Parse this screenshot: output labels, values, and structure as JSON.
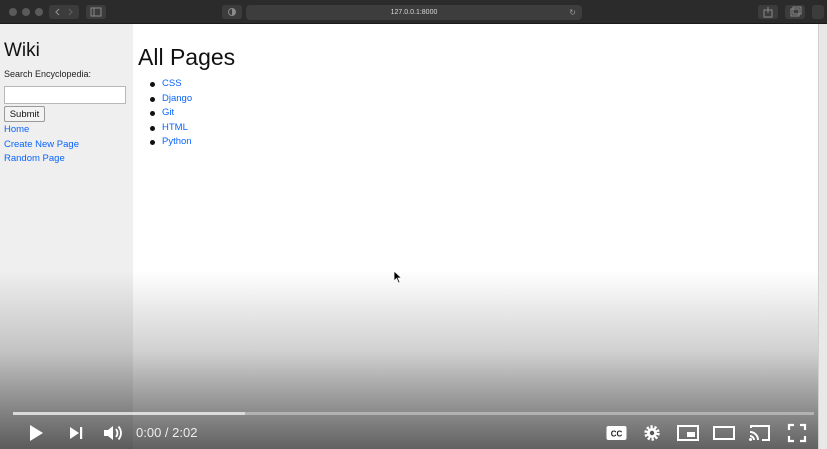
{
  "browser": {
    "url": "127.0.0.1:8000",
    "icons": [
      "traffic-light-icon",
      "back-icon",
      "forward-icon",
      "sidebar-icon",
      "privacy-icon",
      "reload-icon",
      "share-icon",
      "tabs-icon"
    ]
  },
  "sidebar": {
    "title": "Wiki",
    "search_label": "Search Encyclopedia:",
    "search_value": "",
    "submit_label": "Submit",
    "links": [
      "Home",
      "Create New Page",
      "Random Page"
    ]
  },
  "main": {
    "title": "All Pages",
    "pages": [
      "CSS",
      "Django",
      "Git",
      "HTML",
      "Python"
    ]
  },
  "player": {
    "time": "0:00 / 2:02",
    "buffered_fraction": 0.29,
    "controls": [
      "play-icon",
      "next-icon",
      "volume-icon",
      "captions-icon",
      "settings-icon",
      "miniplayer-icon",
      "theater-icon",
      "cast-icon",
      "fullscreen-icon"
    ]
  },
  "colors": {
    "link": "#0a64ff",
    "sidebar_bg": "#efefef"
  }
}
